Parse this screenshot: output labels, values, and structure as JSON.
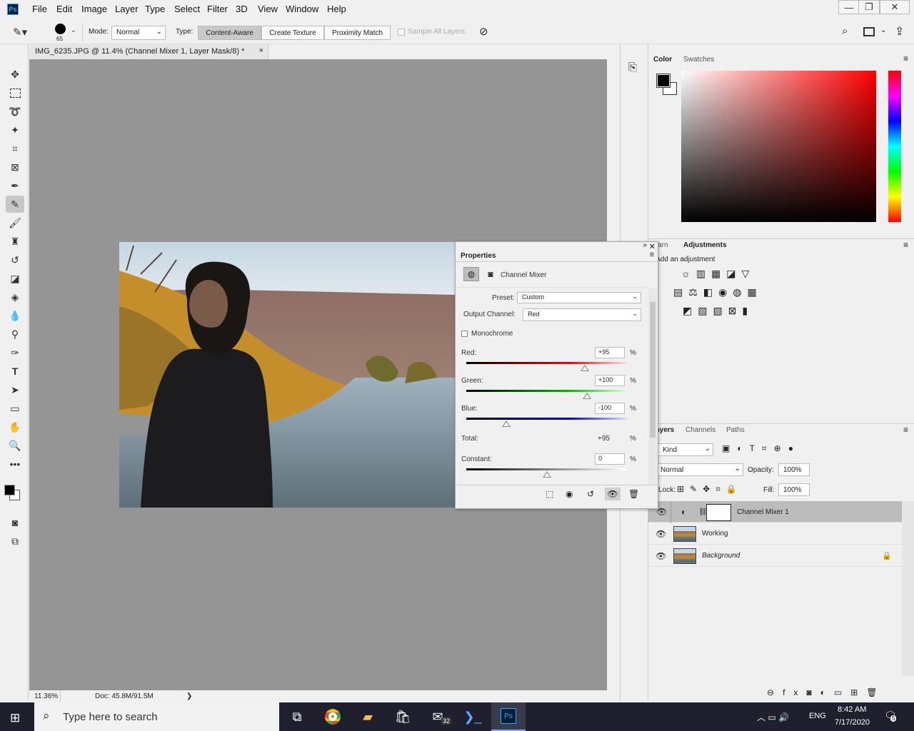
{
  "menu": {
    "logo": "Ps",
    "items": [
      "File",
      "Edit",
      "Image",
      "Layer",
      "Type",
      "Select",
      "Filter",
      "3D",
      "View",
      "Window",
      "Help"
    ]
  },
  "window_controls": {
    "minimize": "—",
    "restore": "❐",
    "close": "✕"
  },
  "options": {
    "brush_size": "65",
    "mode_label": "Mode:",
    "mode_value": "Normal",
    "type_label": "Type:",
    "type_options": [
      "Content-Aware",
      "Create Texture",
      "Proximity Match"
    ],
    "type_selected": "Content-Aware",
    "sample_all_layers": "Sample All Layers"
  },
  "document": {
    "tab_title": "IMG_6235.JPG @ 11.4% (Channel Mixer 1, Layer Mask/8) *",
    "close": "×",
    "zoom": "11.36%",
    "doc_size": "Doc: 45.8M/91.5M",
    "status_arrow": "❯"
  },
  "color_panel": {
    "tabs": [
      "Color",
      "Swatches"
    ],
    "foreground": "#000000",
    "background": "#ffffff",
    "hue_color": "#ff0000"
  },
  "adjustments_panel": {
    "tabs": [
      "Learn",
      "Adjustments"
    ],
    "add_label": "Add an adjustment"
  },
  "properties": {
    "title": "Properties",
    "type_label": "Channel Mixer",
    "preset_label": "Preset:",
    "preset_value": "Custom",
    "output_label": "Output Channel:",
    "output_value": "Red",
    "monochrome": "Monochrome",
    "red_label": "Red:",
    "red_value": "+95",
    "green_label": "Green:",
    "green_value": "+100",
    "blue_label": "Blue:",
    "blue_value": "-100",
    "total_label": "Total:",
    "total_value": "+95",
    "constant_label": "Constant:",
    "constant_value": "0",
    "pct": "%",
    "sliders": {
      "red": 95,
      "green": 100,
      "blue": -100,
      "constant": 0
    }
  },
  "layers_panel": {
    "tabs": [
      "Layers",
      "Channels",
      "Paths"
    ],
    "filter_kind": "Kind",
    "blend_mode": "Normal",
    "opacity_label": "Opacity:",
    "opacity_value": "100%",
    "lock_label": "Lock:",
    "fill_label": "Fill:",
    "fill_value": "100%",
    "layers": [
      {
        "name": "Channel Mixer 1",
        "selected": true
      },
      {
        "name": "Working",
        "selected": false
      },
      {
        "name": "Background",
        "selected": false,
        "locked": true
      }
    ],
    "fx": "fx"
  },
  "taskbar": {
    "search_placeholder": "Type here to search",
    "mail_badge": "32",
    "language": "ENG",
    "time": "8:42 AM",
    "date": "7/17/2020",
    "notifications": "5"
  }
}
